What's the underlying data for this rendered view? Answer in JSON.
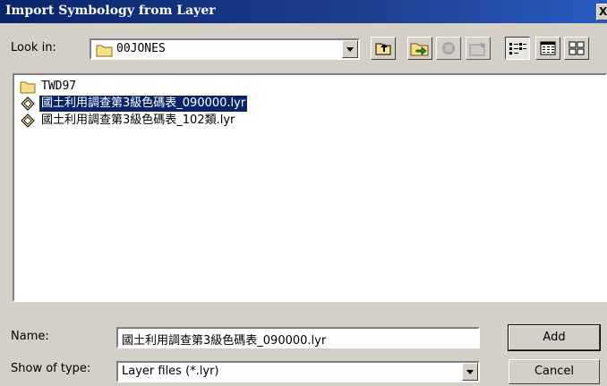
{
  "window": {
    "title": "Import Symbology from Layer",
    "close_label": "X"
  },
  "lookin": {
    "label": "Look in:",
    "value": "00JONES"
  },
  "toolbar": {
    "buttons": [
      "up-one-level-icon",
      "connect-to-folder-icon",
      "disconnect-folder-icon",
      "new-folder-icon",
      "list-view-icon",
      "details-view-icon",
      "thumbnails-view-icon"
    ]
  },
  "files": [
    {
      "name": "TWD97",
      "type": "folder"
    },
    {
      "name": "國土利用調查第3級色碼表_090000.lyr",
      "type": "layer",
      "selected": true
    },
    {
      "name": "國土利用調查第3級色碼表_102類.lyr",
      "type": "layer",
      "selected": false
    }
  ],
  "name_field": {
    "label": "Name:",
    "value": "國土利用調查第3級色碼表_090000.lyr"
  },
  "type_field": {
    "label": "Show of type:",
    "value": "Layer files (*.lyr)"
  },
  "buttons": {
    "add": "Add",
    "cancel": "Cancel"
  },
  "colors": {
    "title_bg": "#0a246a",
    "selection": "#0a246a",
    "face": "#d4d0c8"
  }
}
